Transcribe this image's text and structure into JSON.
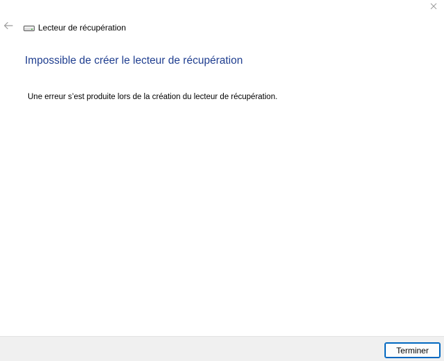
{
  "window": {
    "title": "Lecteur de récupération",
    "icons": {
      "close": "close-icon",
      "back": "back-arrow-icon",
      "drive": "drive-icon"
    }
  },
  "main": {
    "heading": "Impossible de créer le lecteur de récupération",
    "message": "Une erreur s’est produite lors de la création du lecteur de récupération."
  },
  "footer": {
    "finish_label": "Terminer"
  },
  "colors": {
    "heading": "#1e3d8f",
    "accent": "#0067c0",
    "footer_bg": "#f0f0f0"
  }
}
